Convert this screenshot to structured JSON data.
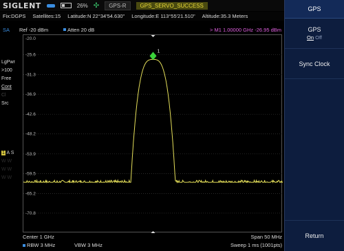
{
  "topbar": {
    "brand": "SIGLENT",
    "battery_pct": "26%",
    "gps_chip": "GPS-R",
    "gps_status": "GPS_SERVO_SUCCESS"
  },
  "info": {
    "fix": "Fix:DGPS",
    "satellites": "Satellites:15",
    "latitude": "Latitude:N 22°34'54.630\"",
    "longitude": "Longitude:E 113°55'21.510\"",
    "altitude": "Altitude:35.3 Meters"
  },
  "measure": {
    "mode": "SA",
    "ref": "Ref  -20 dBm",
    "atten": "Atten  20 dB",
    "marker_readout": ">  M1   1.00000 GHz   -26.95 dBm"
  },
  "side": {
    "detector": "LgPwr",
    "avg": ">100",
    "free": "Free",
    "cont": "Cont",
    "dim1": "Cl",
    "src": "Src",
    "trace_num": "1",
    "trace_a": "A",
    "trace_s": "S"
  },
  "chart_data": {
    "type": "line",
    "ylim": [
      -76.5,
      -20
    ],
    "y_ticks": [
      "-25.6",
      "-31.3",
      "-36.9",
      "-42.6",
      "-48.2",
      "-53.9",
      "-59.5",
      "-65.2",
      "-70.8"
    ],
    "top_tick": "-20.0",
    "x_range_ghz": [
      0.975,
      1.025
    ],
    "noise_floor_dbm": -62,
    "peak": {
      "x_ghz": 1.0,
      "y_dbm": -26.95
    },
    "marker_label": "1",
    "trace_color": "#e6e05a",
    "marker_color": "#3ad13a"
  },
  "bottom": {
    "center": "Center  1 GHz",
    "span": "Span  50 MHz",
    "rbw": "RBW  3 MHz",
    "vbw": "VBW  3 MHz",
    "sweep": "Sweep  1 ms (1001pts)"
  },
  "menu": {
    "title": "GPS",
    "gps_label": "GPS",
    "on": "On",
    "off": "Off",
    "sync": "Sync Clock",
    "return": "Return"
  }
}
